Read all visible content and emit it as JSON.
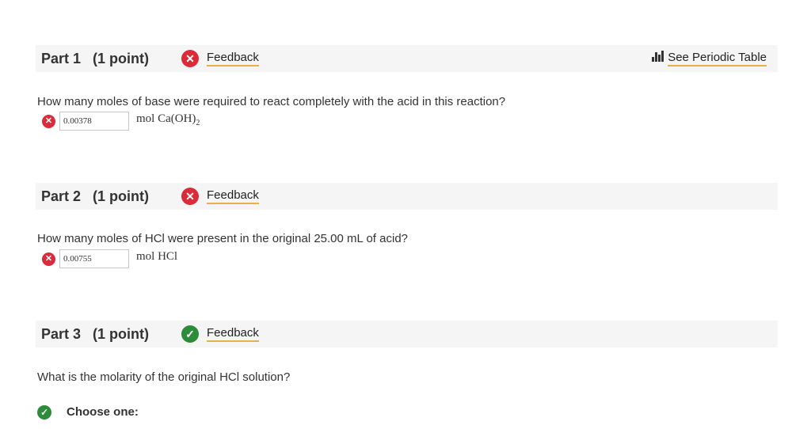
{
  "periodic_table_label": "See Periodic Table",
  "feedback_label": "Feedback",
  "parts": [
    {
      "title": "Part 1   (1 point)",
      "status": "incorrect",
      "question": "How many moles of base were required to react completely with the acid in this reaction?",
      "answer_value": "0.00378",
      "unit": "mol Ca(OH)",
      "unit_subscript": "2"
    },
    {
      "title": "Part 2   (1 point)",
      "status": "incorrect",
      "question": "How many moles of HCl were present in the original 25.00 mL of acid?",
      "answer_value": "0.00755",
      "unit": "mol HCl"
    },
    {
      "title": "Part 3   (1 point)",
      "status": "correct",
      "question": "What is the molarity of the original HCl solution?",
      "choose_label": "Choose one:"
    }
  ],
  "colors": {
    "incorrect": "#d92b3a",
    "correct": "#2e8b3a",
    "link_underline": "#e8b04a",
    "header_bg": "#f5f5f5"
  }
}
